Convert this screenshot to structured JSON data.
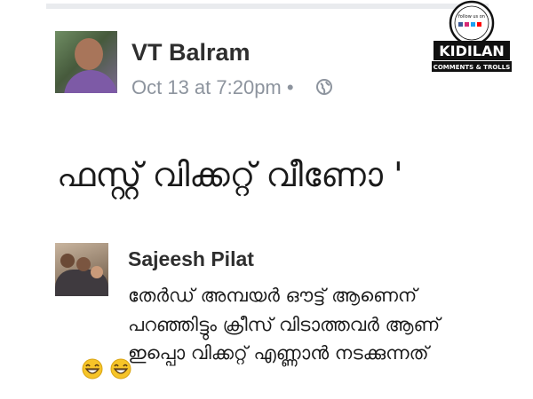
{
  "post": {
    "author": "VT Balram",
    "timestamp": "Oct 13 at 7:20pm",
    "separator": "•",
    "privacy_icon": "globe-icon",
    "text": "ഫസ്റ്റ് വിക്കറ്റ് വീണോ '"
  },
  "comment": {
    "author": "Sajeesh Pilat",
    "lines": [
      "തേർഡ് അമ്പയർ ഔട്ട് ആണെന്",
      "പറഞ്ഞിട്ടും ക്രീസ് വിടാത്തവർ ആണ്",
      "ഇപ്പൊ വിക്കറ്റ് എണ്ണാൻ നടക്കുന്നത്"
    ],
    "emoji_icons": [
      "grinning-face-icon",
      "grinning-face-icon"
    ]
  },
  "watermark": {
    "top_text": "follow us on",
    "brand": "KIDILAN",
    "subtitle": "COMMENTS & TROLLS"
  },
  "colors": {
    "name_text": "#2e2e2e",
    "meta_text": "#8d949e",
    "body_text": "#1a1a1a",
    "emoji_yellow": "#f6c428"
  }
}
